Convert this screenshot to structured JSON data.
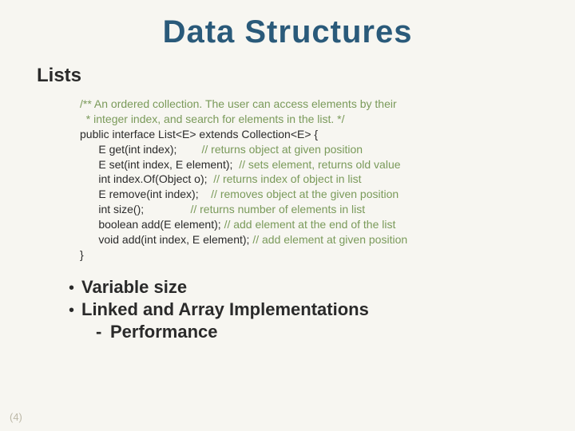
{
  "title": "Data Structures",
  "subtitle": "Lists",
  "code": {
    "line1": "/** An ordered collection. The user can access elements by their",
    "line2": "  * integer index, and search for elements in the list. */",
    "line3": "public interface List<E> extends Collection<E> {",
    "line4a": "      E get(int index);        ",
    "line4b": "// returns object at given position",
    "line5a": "      E set(int index, E element);  ",
    "line5b": "// sets element, returns old value",
    "line6a": "      int index.Of(Object o);  ",
    "line6b": "// returns index of object in list",
    "line7a": "      E remove(int index);    ",
    "line7b": "// removes object at the given position",
    "line8a": "      int size();               ",
    "line8b": "// returns number of elements in list",
    "line9a": "      boolean add(E element); ",
    "line9b": "// add element at the end of the list",
    "line10a": "      void add(int index, E element); ",
    "line10b": "// add element at given position",
    "line11": "}"
  },
  "bullets": {
    "b1": "Variable size",
    "b2": "Linked and Array Implementations",
    "sub1": "Performance"
  },
  "glyphs": {
    "dot": "•",
    "dash": "-"
  },
  "pageNumber": "(4)"
}
